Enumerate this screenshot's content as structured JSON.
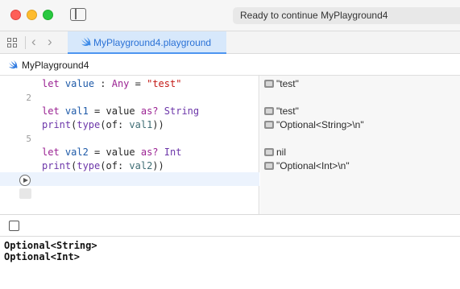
{
  "window": {
    "status_text": "Ready to continue MyPlayground4"
  },
  "tabbar": {
    "tab_label": "MyPlayground4.playground",
    "back_glyph": "‹",
    "forward_glyph": "›"
  },
  "breadcrumb": {
    "label": "MyPlayground4"
  },
  "editor": {
    "line_numbers": [
      "2",
      "5"
    ],
    "lines": [
      {
        "t1": "let",
        "t2": " ",
        "t3": "value",
        "t4": " : ",
        "t5": "Any",
        "t6": " = ",
        "t7": "\"test\""
      },
      {
        "t1": "let",
        "t2": " ",
        "t3": "val1",
        "t4": " = value ",
        "t5": "as?",
        "t6": " ",
        "t7": "String"
      },
      {
        "t1": "print",
        "t2": "(",
        "t3": "type",
        "t4": "(of: ",
        "t5": "val1",
        "t6": "))"
      },
      {
        "t1": "let",
        "t2": " ",
        "t3": "val2",
        "t4": " = value ",
        "t5": "as?",
        "t6": " ",
        "t7": "Int"
      },
      {
        "t1": "print",
        "t2": "(",
        "t3": "type",
        "t4": "(of: ",
        "t5": "val2",
        "t6": "))"
      }
    ]
  },
  "results": [
    "\"test\"",
    "\"test\"",
    "\"Optional<String>\\n\"",
    "nil",
    "\"Optional<Int>\\n\""
  ],
  "console": {
    "lines": [
      "Optional<String>",
      "Optional<Int>"
    ]
  },
  "colors": {
    "keyword": "#9b2393",
    "string": "#c41a16",
    "type": "#6c36a9",
    "accent": "#2b72d6"
  }
}
